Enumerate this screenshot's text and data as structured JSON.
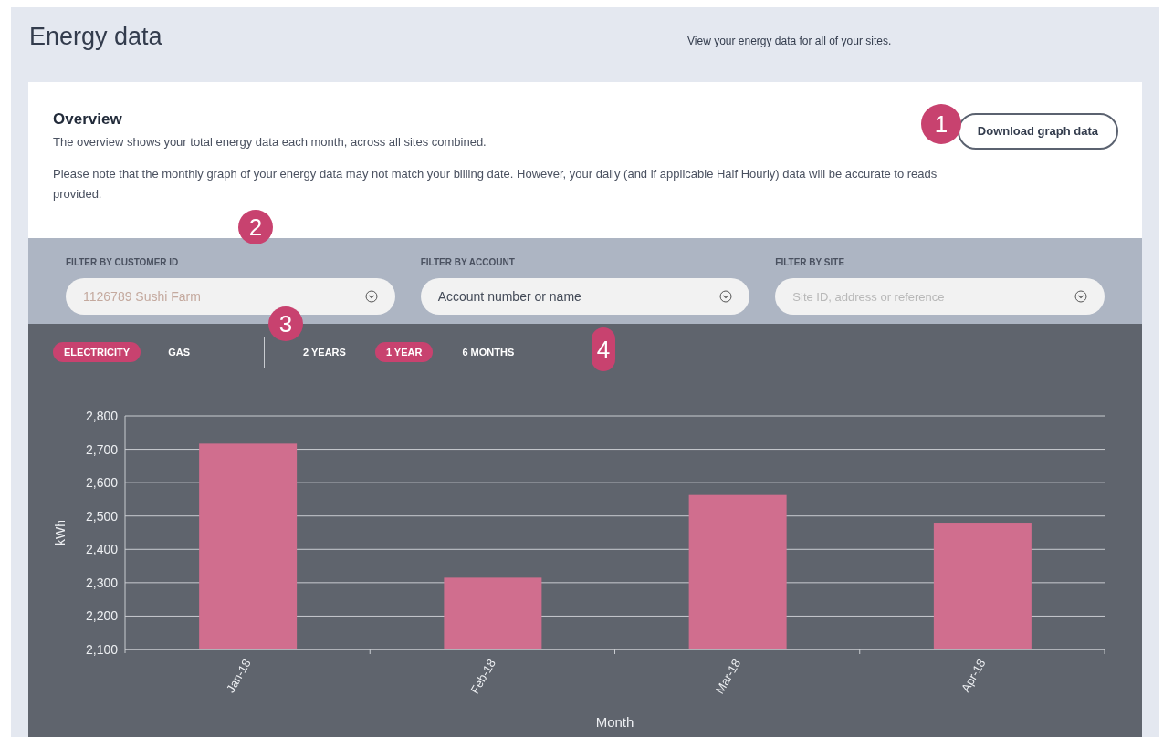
{
  "header": {
    "title": "Energy data",
    "subtitle": "View your energy data for all of your sites."
  },
  "overview": {
    "title": "Overview",
    "paragraphs": [
      "The overview shows your total energy data each month, across all sites combined.",
      "Please note that the monthly graph of your energy data may not match your billing date. However, your daily (and if applicable Half Hourly) data will be accurate to reads provided."
    ],
    "download_button": "Download graph data"
  },
  "filters": [
    {
      "label": "FILTER BY CUSTOMER ID",
      "value": "1126789 Sushi  Farm"
    },
    {
      "label": "FILTER BY ACCOUNT",
      "value": "Account number or name"
    },
    {
      "label": "FILTER BY SITE",
      "placeholder": "Site ID, address or reference"
    }
  ],
  "fuel_tabs": [
    {
      "label": "ELECTRICITY",
      "selected": true
    },
    {
      "label": "GAS",
      "selected": false
    }
  ],
  "period_tabs": [
    {
      "label": "2 YEARS",
      "selected": false
    },
    {
      "label": "1 YEAR",
      "selected": true
    },
    {
      "label": "6 MONTHS",
      "selected": false
    }
  ],
  "callouts": [
    "1",
    "2",
    "3",
    "4"
  ],
  "chart": {
    "chart_data": {
      "type": "bar",
      "xlabel": "Month",
      "ylabel": "kWh",
      "categories": [
        "Jan-18",
        "Feb-18",
        "Mar-18",
        "Apr-18"
      ],
      "series": [
        {
          "color": "#d06e8e",
          "values": [
            2717,
            2315,
            2563,
            2480
          ]
        }
      ],
      "grid": true,
      "ylim": [
        2100,
        2800
      ],
      "yticks": [
        {
          "value": 2100,
          "label": "2,100"
        },
        {
          "value": 2200,
          "label": "2,200"
        },
        {
          "value": 2300,
          "label": "2,300"
        },
        {
          "value": 2400,
          "label": "2,400"
        },
        {
          "value": 2500,
          "label": "2,500"
        },
        {
          "value": 2600,
          "label": "2,600"
        },
        {
          "value": 2700,
          "label": "2,700"
        },
        {
          "value": 2800,
          "label": "2,800"
        }
      ]
    }
  }
}
